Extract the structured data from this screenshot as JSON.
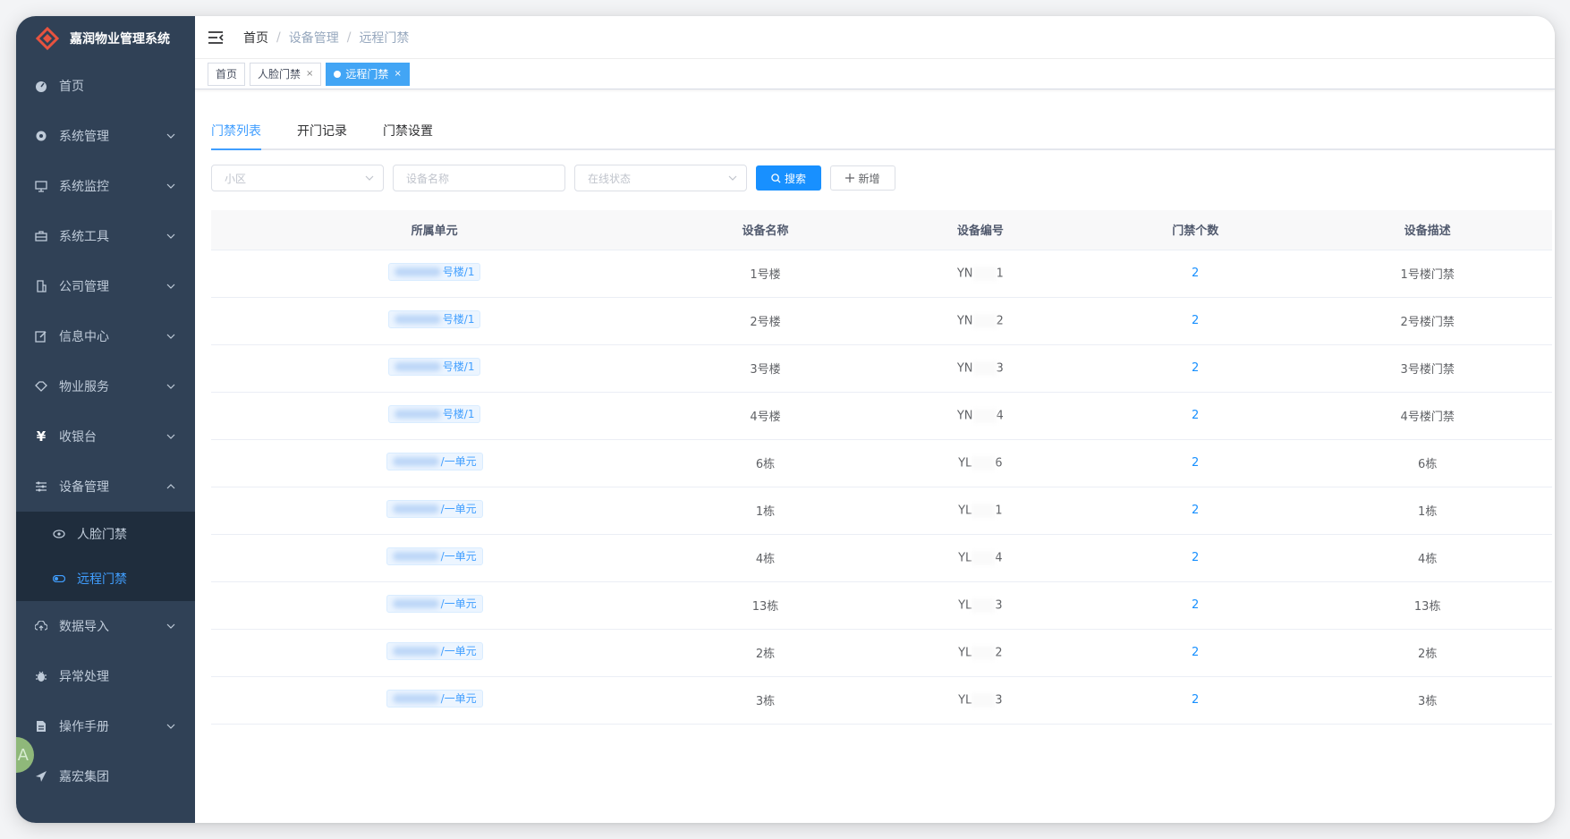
{
  "app": {
    "title": "嘉润物业管理系统"
  },
  "sidebar": {
    "items": [
      {
        "label": "首页",
        "icon": "dashboard-icon"
      },
      {
        "label": "系统管理",
        "icon": "gear-icon"
      },
      {
        "label": "系统监控",
        "icon": "monitor-icon"
      },
      {
        "label": "系统工具",
        "icon": "toolbox-icon"
      },
      {
        "label": "公司管理",
        "icon": "building-icon"
      },
      {
        "label": "信息中心",
        "icon": "edit-icon"
      },
      {
        "label": "物业服务",
        "icon": "handshake-icon"
      },
      {
        "label": "收银台",
        "icon": "yen-icon"
      },
      {
        "label": "设备管理",
        "icon": "sliders-icon"
      },
      {
        "label": "数据导入",
        "icon": "upload-cloud-icon"
      },
      {
        "label": "异常处理",
        "icon": "bug-icon"
      },
      {
        "label": "操作手册",
        "icon": "document-icon"
      },
      {
        "label": "嘉宏集团",
        "icon": "send-icon"
      }
    ],
    "submenu": [
      {
        "label": "人脸门禁",
        "icon": "eye-icon"
      },
      {
        "label": "远程门禁",
        "icon": "toggle-icon"
      }
    ],
    "floating_badge": "A"
  },
  "breadcrumb": {
    "home": "首页",
    "section": "设备管理",
    "page": "远程门禁"
  },
  "tags": [
    {
      "label": "首页"
    },
    {
      "label": "人脸门禁",
      "close": "×"
    },
    {
      "label": "远程门禁",
      "close": "×"
    }
  ],
  "tabs": [
    "门禁列表",
    "开门记录",
    "门禁设置"
  ],
  "filters": {
    "community_placeholder": "小区",
    "device_name_placeholder": "设备名称",
    "status_placeholder": "在线状态",
    "search_label": "搜索",
    "add_label": "新增"
  },
  "table": {
    "headers": [
      "所属单元",
      "设备名称",
      "设备编号",
      "门禁个数",
      "设备描述"
    ],
    "rows": [
      {
        "unit": "号楼/1",
        "name": "1号楼",
        "code_prefix": "YN",
        "code_suffix": "1",
        "count": "2",
        "desc": "1号楼门禁"
      },
      {
        "unit": "号楼/1",
        "name": "2号楼",
        "code_prefix": "YN",
        "code_suffix": "2",
        "count": "2",
        "desc": "2号楼门禁"
      },
      {
        "unit": "号楼/1",
        "name": "3号楼",
        "code_prefix": "YN",
        "code_suffix": "3",
        "count": "2",
        "desc": "3号楼门禁"
      },
      {
        "unit": "号楼/1",
        "name": "4号楼",
        "code_prefix": "YN",
        "code_suffix": "4",
        "count": "2",
        "desc": "4号楼门禁"
      },
      {
        "unit": "/一单元",
        "name": "6栋",
        "code_prefix": "YL",
        "code_suffix": "6",
        "count": "2",
        "desc": "6栋"
      },
      {
        "unit": "/一单元",
        "name": "1栋",
        "code_prefix": "YL",
        "code_suffix": "1",
        "count": "2",
        "desc": "1栋"
      },
      {
        "unit": "/一单元",
        "name": "4栋",
        "code_prefix": "YL",
        "code_suffix": "4",
        "count": "2",
        "desc": "4栋"
      },
      {
        "unit": "/一单元",
        "name": "13栋",
        "code_prefix": "YL",
        "code_suffix": "3",
        "count": "2",
        "desc": "13栋"
      },
      {
        "unit": "/一单元",
        "name": "2栋",
        "code_prefix": "YL",
        "code_suffix": "2",
        "count": "2",
        "desc": "2栋"
      },
      {
        "unit": "/一单元",
        "name": "3栋",
        "code_prefix": "YL",
        "code_suffix": "3",
        "count": "2",
        "desc": "3栋"
      }
    ]
  },
  "colors": {
    "sidebar_bg": "#304156",
    "submenu_bg": "#1f2d3d",
    "accent": "#409eff",
    "primary_button": "#1890ff",
    "logo": "#e8533f"
  }
}
